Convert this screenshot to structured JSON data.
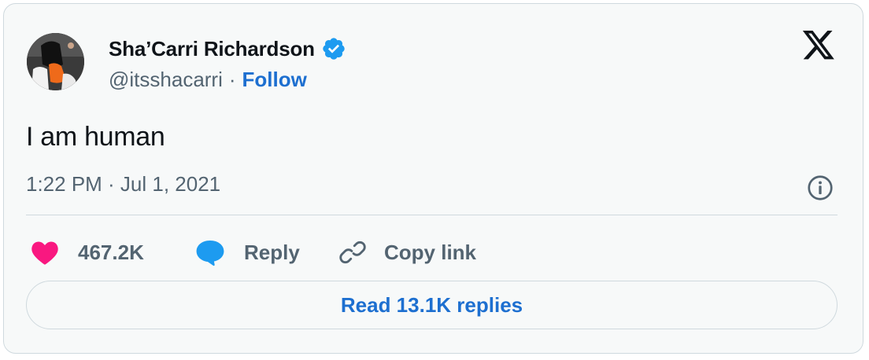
{
  "author": {
    "display_name": "Sha’Carri Richardson",
    "handle": "@itsshacarri",
    "separator": "·",
    "follow_label": "Follow",
    "verified": true
  },
  "tweet": {
    "text": "I am human",
    "timestamp": "1:22 PM · Jul 1, 2021"
  },
  "actions": {
    "like_count": "467.2K",
    "reply_label": "Reply",
    "copy_link_label": "Copy link"
  },
  "read_replies_label": "Read 13.1K replies",
  "colors": {
    "accent": "#1d6fd0",
    "verified": "#1d9bf0",
    "like": "#f91880",
    "reply_icon": "#1d9bf0",
    "muted_text": "#536471",
    "primary_text": "#0f1419",
    "card_bg": "#f7f9f9",
    "border": "#cfd9de"
  },
  "icons": {
    "brand": "x-logo-icon",
    "verified": "verified-badge-icon",
    "info": "info-icon",
    "like": "heart-icon",
    "reply": "speech-bubble-icon",
    "copy_link": "link-icon"
  }
}
